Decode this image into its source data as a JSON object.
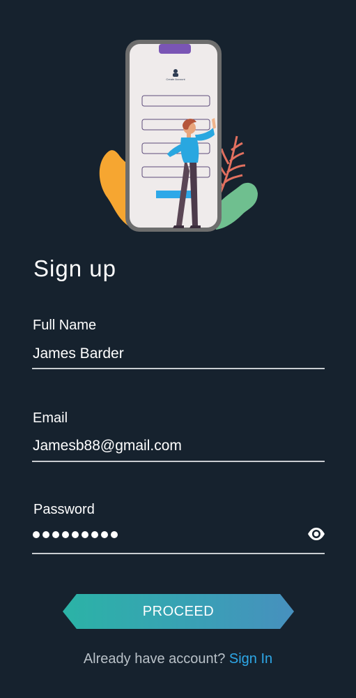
{
  "page": {
    "title": "Sign up"
  },
  "illustration": {
    "icon": "person-phone-signup-illustration",
    "phone_screen_text": "Create Account"
  },
  "form": {
    "full_name": {
      "label": "Full Name",
      "value": "James Barder"
    },
    "email": {
      "label": "Email",
      "value": "Jamesb88@gmail.com"
    },
    "password": {
      "label": "Password",
      "masked_length": 9,
      "toggle_icon": "eye-icon"
    }
  },
  "actions": {
    "proceed_label": "PROCEED",
    "signin_prompt": "Already have account?",
    "signin_link": "Sign In"
  },
  "colors": {
    "background": "#16222e",
    "accent_link": "#2ea8e8",
    "button_gradient_start": "#2bb3a6",
    "button_gradient_end": "#4790be"
  }
}
